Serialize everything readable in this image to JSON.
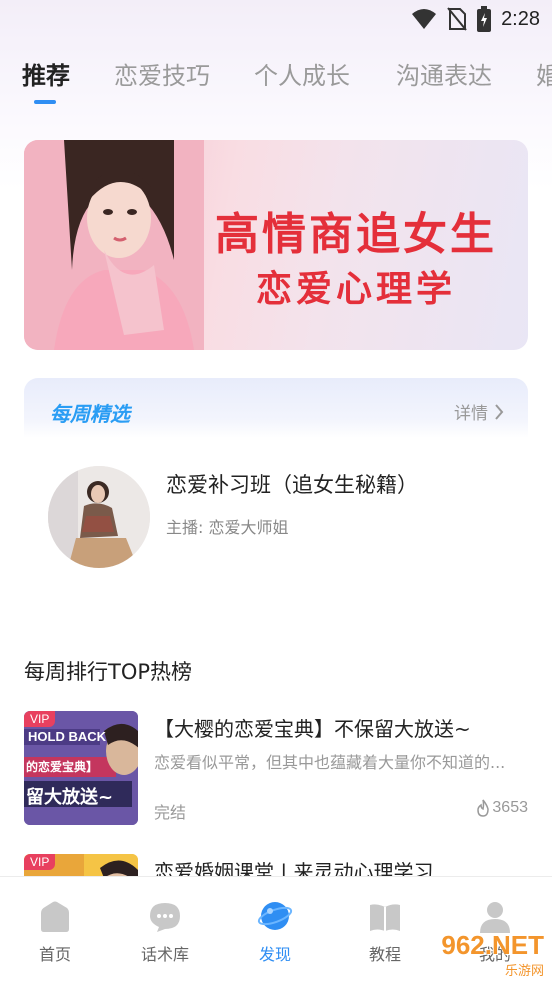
{
  "status_bar": {
    "time": "2:28",
    "icons": [
      "wifi-icon",
      "no-sim-icon",
      "battery-charging-icon"
    ]
  },
  "tabs": [
    {
      "label": "推荐",
      "active": true
    },
    {
      "label": "恋爱技巧",
      "active": false
    },
    {
      "label": "个人成长",
      "active": false
    },
    {
      "label": "沟通表达",
      "active": false
    },
    {
      "label": "婚",
      "active": false
    }
  ],
  "banner": {
    "title": "高情商追女生",
    "subtitle": "恋爱心理学"
  },
  "weekly_pick": {
    "heading": "每周精选",
    "more_label": "详情",
    "item": {
      "title": "恋爱补习班（追女生秘籍）",
      "host": "主播: 恋爱大师姐"
    }
  },
  "ranking": {
    "heading": "每周排行TOP热榜",
    "items": [
      {
        "badge": "VIP",
        "thumb_lines": [
          "HOLD BACK",
          "的恋爱宝典】",
          "留大放送~"
        ],
        "title": "【大樱的恋爱宝典】不保留大放送~",
        "desc": "恋爱看似平常，但其中也蕴藏着大量你不知道的...",
        "status": "完结",
        "plays": "3653"
      },
      {
        "badge": "VIP",
        "title": "恋爱婚姻课堂 | 来灵动心理学习"
      }
    ]
  },
  "bottom_nav": [
    {
      "label": "首页",
      "icon": "home-icon",
      "active": false
    },
    {
      "label": "话术库",
      "icon": "chat-bubble-icon",
      "active": false
    },
    {
      "label": "发现",
      "icon": "planet-icon",
      "active": true
    },
    {
      "label": "教程",
      "icon": "book-icon",
      "active": false
    },
    {
      "label": "我的",
      "icon": "profile-icon",
      "active": false
    }
  ],
  "watermark": {
    "text": "962.NET",
    "subtext": "乐游网"
  },
  "colors": {
    "accent": "#2f8ef3",
    "banner_text": "#e42f3a",
    "vip": "#e8405f",
    "weekly_title": "#2a9df4"
  }
}
